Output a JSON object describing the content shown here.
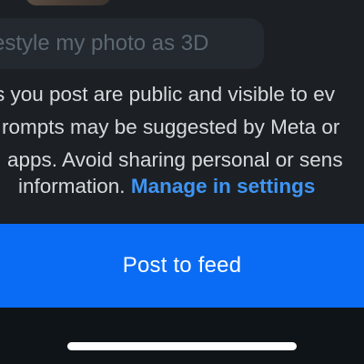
{
  "prompt": {
    "text": "estyle my photo as 3D"
  },
  "disclaimer": {
    "line1": "s you post are public and visible to ev",
    "line2": "rompts may be suggested by Meta or",
    "line3": "apps. Avoid sharing personal or sens",
    "line4_prefix": "information.",
    "manage_link": "Manage in settings"
  },
  "actions": {
    "post_label": "Post to feed"
  },
  "colors": {
    "link": "#3e95f5",
    "primary_button": "#0a6cf5",
    "background": "#1c2024"
  }
}
